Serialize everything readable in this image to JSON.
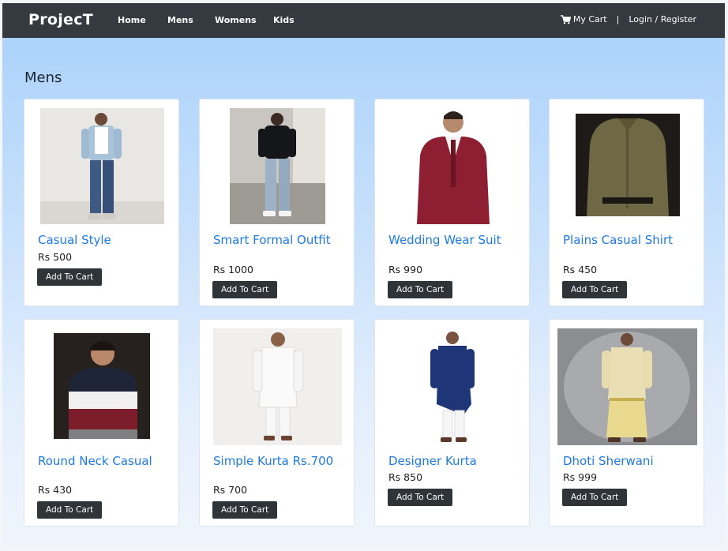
{
  "nav": {
    "brand": "ProjecT",
    "links": [
      "Home",
      "Mens",
      "Womens",
      "Kids"
    ],
    "cart_label": "My Cart",
    "separator": "|",
    "login_label": "Login / Register"
  },
  "section_title": "Mens",
  "products": [
    {
      "title": "Casual Style",
      "price": "Rs 500",
      "button": "Add To Cart"
    },
    {
      "title": "Smart Formal Outfit",
      "price": "Rs 1000",
      "button": "Add To Cart"
    },
    {
      "title": "Wedding Wear Suit",
      "price": "Rs 990",
      "button": "Add To Cart"
    },
    {
      "title": "Plains Casual Shirt",
      "price": "Rs 450",
      "button": "Add To Cart"
    },
    {
      "title": "Round Neck Casual",
      "price": "Rs 430",
      "button": "Add To Cart"
    },
    {
      "title": "Simple Kurta Rs.700",
      "price": "Rs 700",
      "button": "Add To Cart"
    },
    {
      "title": "Designer Kurta",
      "price": "Rs 850",
      "button": "Add To Cart"
    },
    {
      "title": "Dhoti Sherwani",
      "price": "Rs 999",
      "button": "Add To Cart"
    }
  ]
}
